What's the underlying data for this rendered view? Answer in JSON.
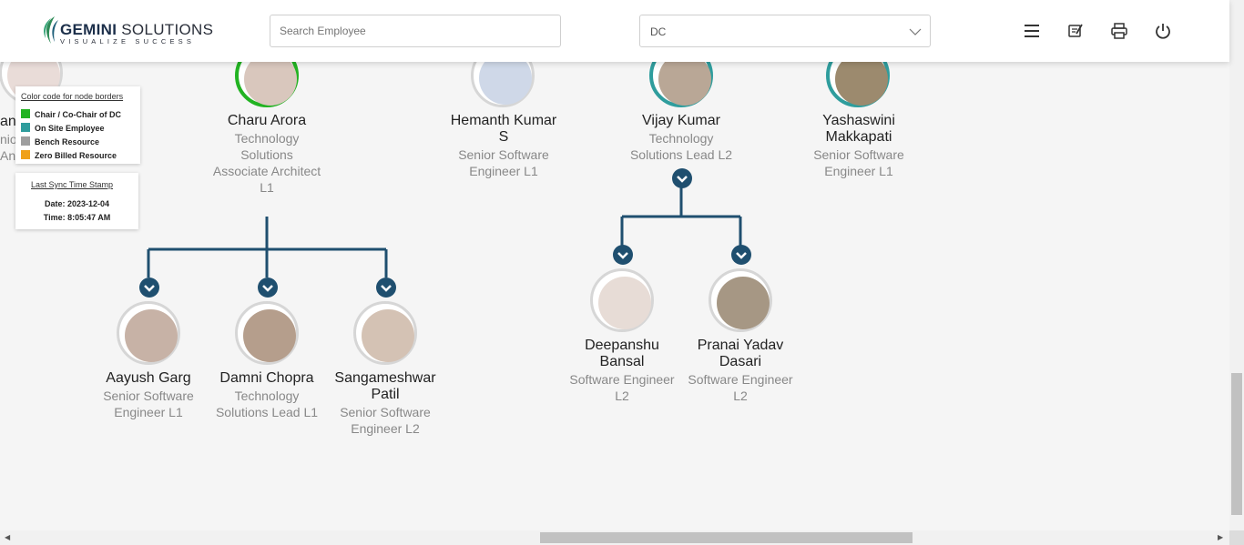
{
  "header": {
    "logo_brand": "GEMINI",
    "logo_suffix": "SOLUTIONS",
    "logo_tagline": "VISUALIZE SUCCESS",
    "search_placeholder": "Search Employee",
    "dept_selected": "DC",
    "icons": [
      "menu-icon",
      "edit-note-icon",
      "print-icon",
      "power-icon"
    ]
  },
  "legend": {
    "title": "Color code for node borders",
    "items": [
      {
        "label": "Chair / Co-Chair of DC",
        "color": "#22b322"
      },
      {
        "label": "On Site Employee",
        "color": "#2f9d9d"
      },
      {
        "label": "Bench Resource",
        "color": "#9e9e9e"
      },
      {
        "label": "Zero Billed Resource",
        "color": "#f0a11a"
      }
    ]
  },
  "sync": {
    "title": "Last Sync Time Stamp",
    "date_label": "Date: 2023-12-04",
    "time_label": "Time: 8:05:47 AM"
  },
  "colors": {
    "connector": "#1f4f6f",
    "border_chair": "#22b322",
    "border_onsite": "#2f9d9d",
    "border_default": "#d6d6d6"
  },
  "partial_node": {
    "name_fragment": "ank",
    "role_line1": "nio",
    "role_line2": "An"
  },
  "nodes": [
    {
      "name": "Charu Arora",
      "role": [
        "Technology",
        "Solutions",
        "Associate Architect",
        "L1"
      ],
      "border": "chair"
    },
    {
      "name": "Hemanth Kumar S",
      "name_lines": [
        "Hemanth Kumar",
        "S"
      ],
      "role": [
        "Senior Software",
        "Engineer L1"
      ],
      "border": "default"
    },
    {
      "name": "Vijay Kumar",
      "role": [
        "Technology",
        "Solutions Lead L2"
      ],
      "border": "onsite"
    },
    {
      "name": "Yashaswini Makkapati",
      "name_lines": [
        "Yashaswini",
        "Makkapati"
      ],
      "role": [
        "Senior Software",
        "Engineer L1"
      ],
      "border": "onsite"
    },
    {
      "name": "Aayush Garg",
      "role": [
        "Senior Software",
        "Engineer L1"
      ],
      "border": "default"
    },
    {
      "name": "Damni Chopra",
      "role": [
        "Technology",
        "Solutions Lead L1"
      ],
      "border": "default"
    },
    {
      "name": "Sangameshwar Patil",
      "name_lines": [
        "Sangameshwar",
        "Patil"
      ],
      "role": [
        "Senior Software",
        "Engineer L2"
      ],
      "border": "default"
    },
    {
      "name": "Deepanshu Bansal",
      "name_lines": [
        "Deepanshu",
        "Bansal"
      ],
      "role": [
        "Software Engineer",
        "L2"
      ],
      "border": "default"
    },
    {
      "name": "Pranai Yadav Dasari",
      "name_lines": [
        "Pranai Yadav",
        "Dasari"
      ],
      "role": [
        "Software Engineer",
        "L2"
      ],
      "border": "default"
    }
  ]
}
